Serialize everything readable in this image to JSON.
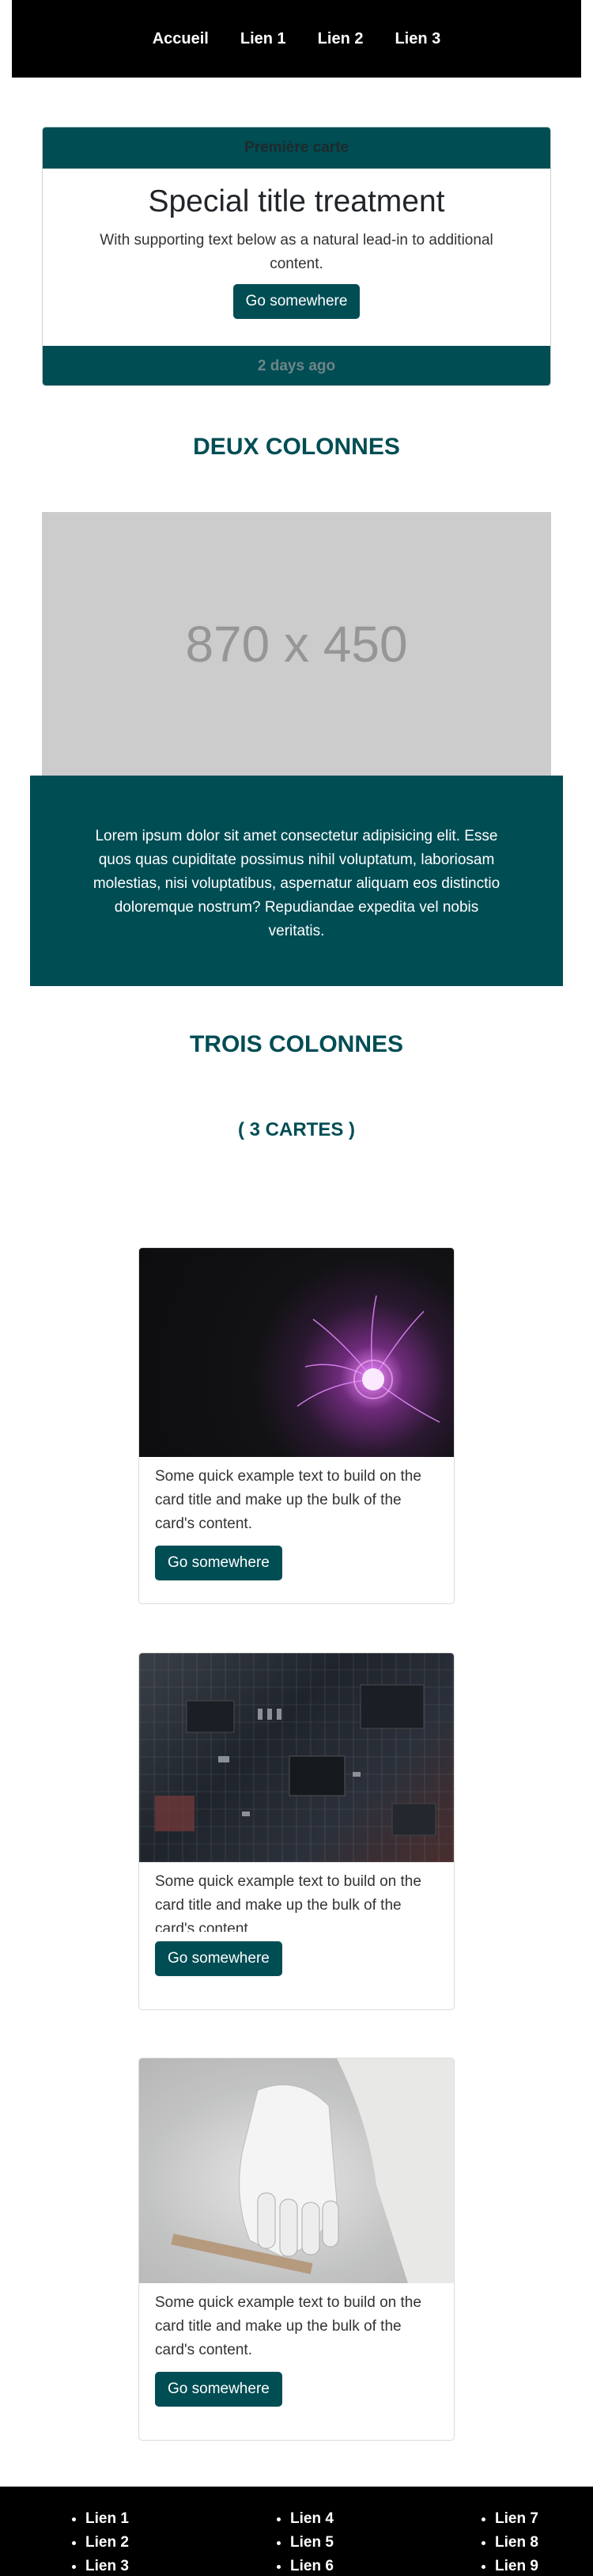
{
  "nav": {
    "items": [
      "Accueil",
      "Lien 1",
      "Lien 2",
      "Lien 3"
    ]
  },
  "top_card": {
    "header": "Première carte",
    "title": "Special title treatment",
    "text": "With supporting text below as a natural lead-in to additional content.",
    "button": "Go somewhere",
    "footer": "2 days ago"
  },
  "two_columns": {
    "title": "DEUX COLONNES",
    "placeholder": "870 x 450",
    "text": "Lorem ipsum dolor sit amet consectetur adipisicing elit. Esse quos quas cupiditate possimus nihil voluptatum, laboriosam molestias, nisi voluptatibus, aspernatur aliquam eos distinctio doloremque nostrum? Repudiandae expedita vel nobis veritatis."
  },
  "three_columns": {
    "title": "TROIS COLONNES",
    "subtitle": "( 3 CARTES )",
    "cards": [
      {
        "image": "plasma-ball-image",
        "text": "Some quick example text to build on the card title and make up the bulk of the card's content.",
        "button": "Go somewhere"
      },
      {
        "image": "circuit-board-image",
        "text": "Some quick example text to build on the card title and make up the bulk of the card's content.",
        "button": "Go somewhere"
      },
      {
        "image": "robot-hand-image",
        "text": "Some quick example text to build on the card title and make up the bulk of the card's content.",
        "button": "Go somewhere"
      }
    ]
  },
  "footer": {
    "col1": [
      "Lien 1",
      "Lien 2",
      "Lien 3"
    ],
    "col2": [
      "Lien 4",
      "Lien 5",
      "Lien 6"
    ],
    "col3": [
      "Lien 7",
      "Lien 8",
      "Lien 9"
    ]
  },
  "colors": {
    "primary": "#004d54",
    "nav_bg": "#000000",
    "placeholder_bg": "#cccccc"
  }
}
